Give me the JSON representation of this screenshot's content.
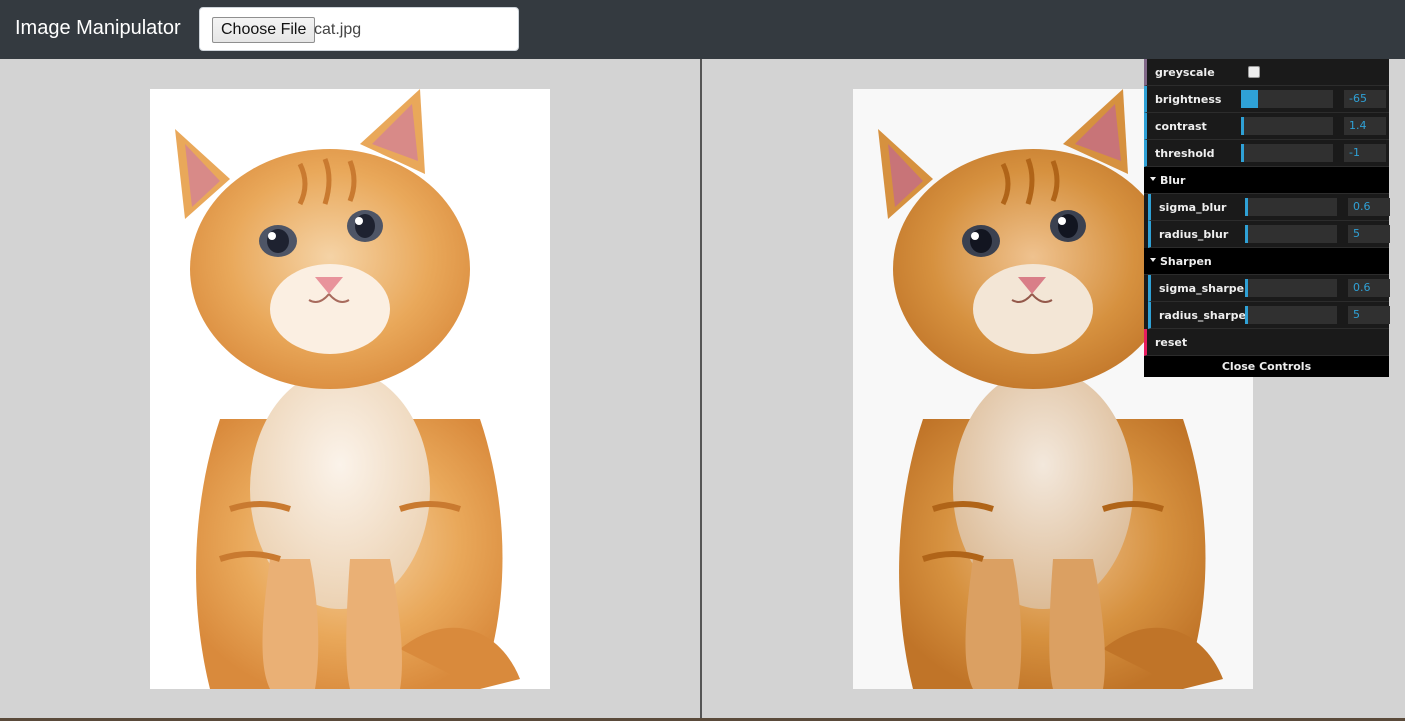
{
  "app": {
    "brand": "Image Manipulator",
    "file_button": "Choose File",
    "file_name": "cat.jpg"
  },
  "images": {
    "original_alt": "cat",
    "processed_alt": "cat processed"
  },
  "gui": {
    "controls": [
      {
        "id": "greyscale",
        "label": "greyscale",
        "type": "boolean",
        "checked": false
      },
      {
        "id": "brightness",
        "label": "brightness",
        "type": "number",
        "value": "-65",
        "fill": 0.18
      },
      {
        "id": "contrast",
        "label": "contrast",
        "type": "number",
        "value": "1.4",
        "fill": 0.03
      },
      {
        "id": "threshold",
        "label": "threshold",
        "type": "number",
        "value": "-1",
        "fill": 0.0
      }
    ],
    "blur": {
      "title": "Blur",
      "controls": [
        {
          "id": "sigma_blur",
          "label": "sigma_blur",
          "value": "0.6",
          "fill": 0.03
        },
        {
          "id": "radius_blur",
          "label": "radius_blur",
          "value": "5",
          "fill": 0.02
        }
      ]
    },
    "sharpen": {
      "title": "Sharpen",
      "controls": [
        {
          "id": "sigma_sharpen",
          "label": "sigma_sharpen",
          "value": "0.6",
          "fill": 0.03
        },
        {
          "id": "radius_sharpen",
          "label": "radius_sharpen",
          "value": "5",
          "fill": 0.02
        }
      ]
    },
    "reset_label": "reset",
    "close_label": "Close Controls"
  },
  "colors": {
    "navbar": "#343a40",
    "background": "#d3d3d3",
    "gui_number_accent": "#2fa1d6",
    "gui_function_accent": "#e61d5f",
    "gui_boolean_accent": "#806787"
  }
}
